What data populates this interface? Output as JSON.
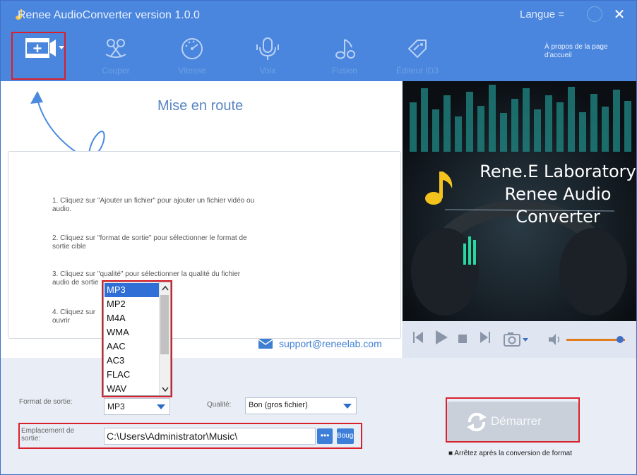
{
  "window": {
    "title": "Renee AudioConverter version 1.0.0",
    "langue_label": "Langue =",
    "close_glyph": "✕"
  },
  "toolbar": {
    "items": [
      {
        "label": "",
        "icon": "add-file-icon"
      },
      {
        "label": "Couper",
        "icon": "scissors-icon"
      },
      {
        "label": "Vitesse",
        "icon": "speedometer-icon"
      },
      {
        "label": "Voix",
        "icon": "microphone-icon"
      },
      {
        "label": "Fusion",
        "icon": "music-note-icon"
      },
      {
        "label": "Éditeur ID3",
        "icon": "tag-icon"
      }
    ],
    "about_label": "À propos de la page d'accueil"
  },
  "main": {
    "heading": "Mise en route",
    "steps": [
      "1. Cliquez sur \"Ajouter un fichier\" pour ajouter un fichier vidéo ou audio.",
      "2. Cliquez sur \"format de sortie\" pour sélectionner le format de sortie cible",
      "3. Cliquez sur \"qualité\" pour sélectionner la qualité du fichier audio de sortie",
      "4. Cliquez sur ouvrir"
    ],
    "support_email": "support@reneelab.com"
  },
  "preview": {
    "line1": "Rene.E Laboratory",
    "line2": "Renee Audio",
    "line3": "Converter"
  },
  "player": {
    "volume": 0.92
  },
  "output": {
    "format_label": "Format de sortie:",
    "format_value": "MP3",
    "format_options": [
      "MP3",
      "MP2",
      "M4A",
      "WMA",
      "AAC",
      "AC3",
      "FLAC",
      "WAV"
    ],
    "quality_label": "Qualité:",
    "quality_value": "Bon (gros fichier)",
    "location_label": "Emplacement de sortie:",
    "location_value": "C:\\Users\\Administrator\\Music\\",
    "browse_label": "•••",
    "open_label": "Bouge",
    "start_label": "Démarrer",
    "stop_after_label": "Arrêtez après la conversion de format"
  },
  "colors": {
    "toolbar_bg": "#4a86dd",
    "highlight": "#d8212c",
    "volume_accent": "#e07c1e"
  }
}
